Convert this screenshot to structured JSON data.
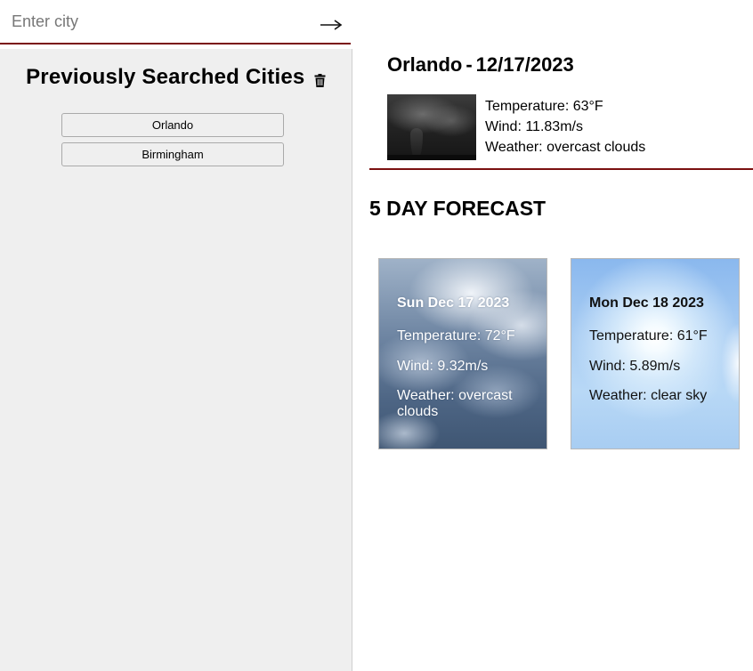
{
  "search": {
    "placeholder": "Enter city",
    "value": "",
    "submit_icon": "arrow-right-icon"
  },
  "history": {
    "title": "Previously Searched Cities",
    "clear_icon": "trash-icon",
    "items": [
      {
        "label": "Orlando"
      },
      {
        "label": "Birmingham"
      }
    ]
  },
  "current": {
    "city": "Orlando",
    "separator": "-",
    "date": "12/17/2023",
    "image_description_icon": "overcast-clouds-image",
    "temperature": "Temperature: 63°F",
    "wind": "Wind: 11.83m/s",
    "weather": "Weather: overcast clouds"
  },
  "forecast": {
    "title": "5 DAY FORECAST",
    "days": [
      {
        "date": "Sun Dec 17 2023",
        "temperature": "Temperature: 72°F",
        "wind": "Wind: 9.32m/s",
        "weather": "Weather: overcast clouds"
      },
      {
        "date": "Mon Dec 18 2023",
        "temperature": "Temperature: 61°F",
        "wind": "Wind: 5.89m/s",
        "weather": "Weather: clear sky"
      }
    ]
  },
  "colors": {
    "accent_rule": "#7a1010",
    "sidebar_bg": "#efefef"
  }
}
